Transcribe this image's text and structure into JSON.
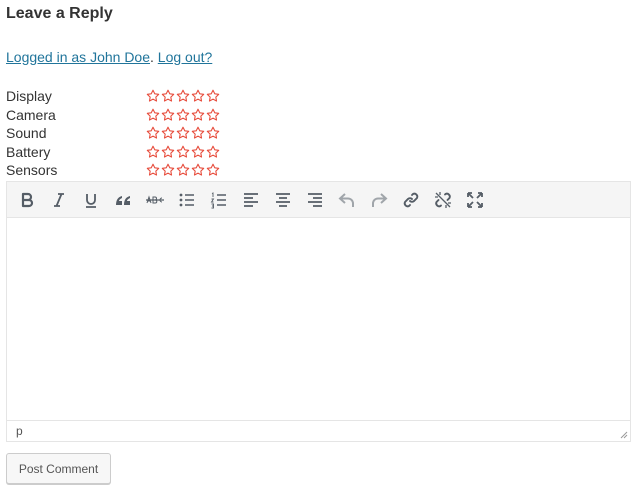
{
  "heading": "Leave a Reply",
  "logged_in": {
    "user_link": "Logged in as John Doe",
    "separator": ".",
    "logout_link": "Log out?"
  },
  "ratings": [
    {
      "label": "Display",
      "stars": 5,
      "filled": 0
    },
    {
      "label": "Camera",
      "stars": 5,
      "filled": 0
    },
    {
      "label": "Sound",
      "stars": 5,
      "filled": 0
    },
    {
      "label": "Battery",
      "stars": 5,
      "filled": 0
    },
    {
      "label": "Sensors",
      "stars": 5,
      "filled": 0
    }
  ],
  "colors": {
    "star": "#e74c3c",
    "link": "#21759b",
    "toolbar_bg": "#f5f5f5",
    "icon": "#555d66",
    "icon_disabled": "#a0a5aa"
  },
  "toolbar": [
    {
      "name": "bold-icon",
      "enabled": true
    },
    {
      "name": "italic-icon",
      "enabled": true
    },
    {
      "name": "underline-icon",
      "enabled": true
    },
    {
      "name": "blockquote-icon",
      "enabled": true
    },
    {
      "name": "strikethrough-icon",
      "enabled": true
    },
    {
      "name": "bulleted-list-icon",
      "enabled": true
    },
    {
      "name": "numbered-list-icon",
      "enabled": true
    },
    {
      "name": "align-left-icon",
      "enabled": true
    },
    {
      "name": "align-center-icon",
      "enabled": true
    },
    {
      "name": "align-right-icon",
      "enabled": true
    },
    {
      "name": "undo-icon",
      "enabled": false
    },
    {
      "name": "redo-icon",
      "enabled": false
    },
    {
      "name": "insert-link-icon",
      "enabled": true
    },
    {
      "name": "remove-link-icon",
      "enabled": true
    },
    {
      "name": "fullscreen-icon",
      "enabled": true
    }
  ],
  "editor": {
    "content": "",
    "path": "p"
  },
  "submit_label": "Post Comment"
}
